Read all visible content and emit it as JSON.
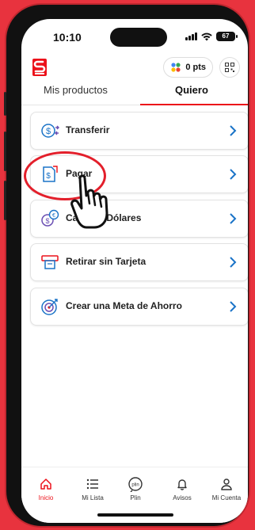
{
  "status_bar": {
    "time": "10:10",
    "battery": "67"
  },
  "header": {
    "points_label": "0 pts"
  },
  "tabs": [
    {
      "label": "Mis productos"
    },
    {
      "label": "Quiero"
    }
  ],
  "menu": [
    {
      "label": "Transferir",
      "icon": "transfer-dollar-icon"
    },
    {
      "label": "Pagar",
      "icon": "payment-invoice-icon"
    },
    {
      "label": "Cambiar Dólares",
      "icon": "currency-exchange-icon"
    },
    {
      "label": "Retirar sin Tarjeta",
      "icon": "atm-withdraw-icon"
    },
    {
      "label": "Crear una Meta de Ahorro",
      "icon": "savings-goal-icon"
    }
  ],
  "bottom_nav": [
    {
      "label": "Inicio",
      "icon": "home-icon",
      "active": true
    },
    {
      "label": "Mi Lista",
      "icon": "list-icon"
    },
    {
      "label": "Plin",
      "icon": "plin-icon"
    },
    {
      "label": "Avisos",
      "icon": "bell-icon"
    },
    {
      "label": "Mi Cuenta",
      "icon": "user-icon"
    }
  ],
  "colors": {
    "brand": "#ec111a",
    "background": "#e8333e",
    "accent_blue": "#1a73c7"
  }
}
